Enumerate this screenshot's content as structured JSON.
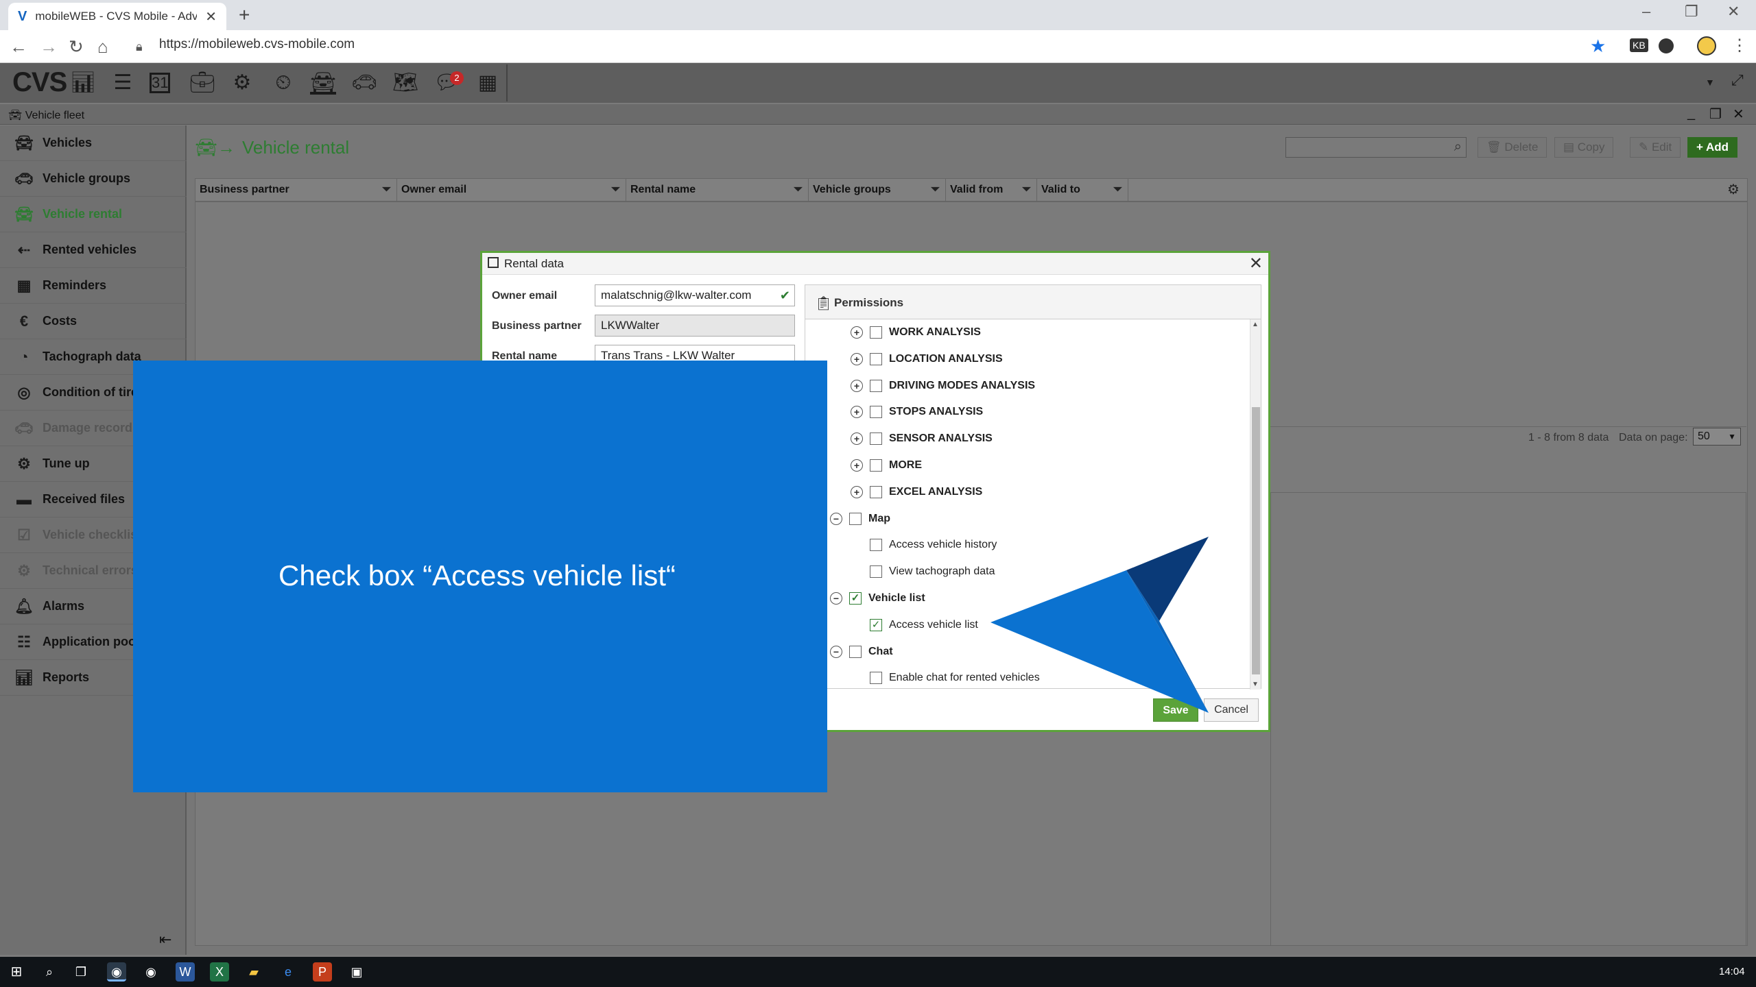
{
  "browser": {
    "tab_title": "mobileWEB - CVS Mobile - Adva",
    "url": "https://mobileweb.cvs-mobile.com",
    "new_tab": "+",
    "ext_label": "KB"
  },
  "app": {
    "logo": "CVS",
    "notification_count": "2",
    "window_title": "Vehicle fleet"
  },
  "sidebar": {
    "items": [
      {
        "label": "Vehicles",
        "icon": "vehicles-icon",
        "state": "normal"
      },
      {
        "label": "Vehicle groups",
        "icon": "vehicle-groups-icon",
        "state": "normal"
      },
      {
        "label": "Vehicle rental",
        "icon": "vehicle-rental-icon",
        "state": "active"
      },
      {
        "label": "Rented vehicles",
        "icon": "rented-vehicles-icon",
        "state": "normal"
      },
      {
        "label": "Reminders",
        "icon": "calendar-icon",
        "state": "normal"
      },
      {
        "label": "Costs",
        "icon": "costs-icon",
        "state": "normal"
      },
      {
        "label": "Tachograph data",
        "icon": "tachograph-icon",
        "state": "normal"
      },
      {
        "label": "Condition of tires",
        "icon": "tire-icon",
        "state": "normal"
      },
      {
        "label": "Damage records",
        "icon": "damage-icon",
        "state": "disabled"
      },
      {
        "label": "Tune up",
        "icon": "tune-up-icon",
        "state": "normal"
      },
      {
        "label": "Received files",
        "icon": "folder-icon",
        "state": "normal"
      },
      {
        "label": "Vehicle checklist",
        "icon": "checklist-icon",
        "state": "disabled"
      },
      {
        "label": "Technical errors",
        "icon": "engine-icon",
        "state": "disabled"
      },
      {
        "label": "Alarms",
        "icon": "bell-icon",
        "state": "normal"
      },
      {
        "label": "Application pool",
        "icon": "application-pool-icon",
        "state": "normal"
      },
      {
        "label": "Reports",
        "icon": "reports-icon",
        "state": "normal"
      }
    ]
  },
  "main": {
    "title": "Vehicle rental",
    "buttons": {
      "delete": "Delete",
      "copy": "Copy",
      "edit": "Edit",
      "add": "+ Add"
    },
    "columns": [
      "Business partner",
      "Owner email",
      "Rental name",
      "Vehicle groups",
      "Valid from",
      "Valid to"
    ],
    "pager": {
      "info": "1 - 8 from 8 data",
      "label": "Data on page:",
      "size": "50"
    }
  },
  "dialog": {
    "title": "Rental data",
    "owner_email_label": "Owner email",
    "owner_email": "malatschnig@lkw-walter.com",
    "business_partner_label": "Business partner",
    "business_partner": "LKWWalter",
    "rental_name_label": "Rental name",
    "rental_name": "Trans Trans - LKW Walter",
    "permissions_title": "Permissions",
    "tree": [
      {
        "label": "WORK ANALYSIS",
        "level": 1,
        "expander": "+",
        "checked": false,
        "bold": true
      },
      {
        "label": "LOCATION ANALYSIS",
        "level": 1,
        "expander": "+",
        "checked": false,
        "bold": true
      },
      {
        "label": "DRIVING MODES ANALYSIS",
        "level": 1,
        "expander": "+",
        "checked": false,
        "bold": true
      },
      {
        "label": "STOPS ANALYSIS",
        "level": 1,
        "expander": "+",
        "checked": false,
        "bold": true
      },
      {
        "label": "SENSOR ANALYSIS",
        "level": 1,
        "expander": "+",
        "checked": false,
        "bold": true
      },
      {
        "label": "MORE",
        "level": 1,
        "expander": "+",
        "checked": false,
        "bold": true
      },
      {
        "label": "EXCEL ANALYSIS",
        "level": 1,
        "expander": "+",
        "checked": false,
        "bold": true
      },
      {
        "label": "Map",
        "level": 0,
        "expander": "−",
        "checked": false,
        "bold": true
      },
      {
        "label": "Access vehicle history",
        "level": 1,
        "expander": "",
        "checked": false,
        "bold": false
      },
      {
        "label": "View tachograph data",
        "level": 1,
        "expander": "",
        "checked": false,
        "bold": false
      },
      {
        "label": "Vehicle list",
        "level": 0,
        "expander": "−",
        "checked": true,
        "bold": true
      },
      {
        "label": "Access vehicle list",
        "level": 1,
        "expander": "",
        "checked": true,
        "bold": false
      },
      {
        "label": "Chat",
        "level": 0,
        "expander": "−",
        "checked": false,
        "bold": true
      },
      {
        "label": "Enable chat for rented vehicles",
        "level": 1,
        "expander": "",
        "checked": false,
        "bold": false
      }
    ],
    "save": "Save",
    "cancel": "Cancel"
  },
  "instruction": {
    "text": "Check box “Access vehicle list“",
    "background_color": "#0b72d0"
  },
  "taskbar": {
    "clock": "14:04"
  },
  "colors": {
    "accent_green": "#5ba33a",
    "active_green": "#2e7d32",
    "instruction_blue": "#0b72d0",
    "arrow_dark": "#0a3a78"
  }
}
